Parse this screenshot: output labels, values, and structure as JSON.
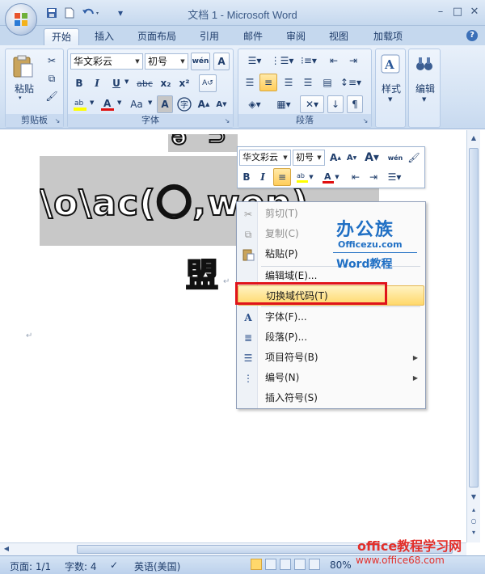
{
  "window": {
    "title": "文档 1 - Microsoft Word",
    "minimize": "–",
    "maximize": "□",
    "close": "✕"
  },
  "qat": {
    "save_icon": "save-icon",
    "new_icon": "new-doc-icon",
    "undo_icon": "undo-icon",
    "customize": "▾"
  },
  "tabs": [
    "开始",
    "插入",
    "页面布局",
    "引用",
    "邮件",
    "审阅",
    "视图",
    "加载项"
  ],
  "ribbon": {
    "clipboard": {
      "paste": "粘贴",
      "label": "剪贴板"
    },
    "font": {
      "font_name": "华文彩云",
      "font_size": "初号",
      "bold": "B",
      "italic": "I",
      "underline": "U",
      "strike": "abc",
      "subscript": "x₂",
      "superscript": "x²",
      "aa": "Aa",
      "label": "字体"
    },
    "paragraph": {
      "label": "段落"
    },
    "styles": {
      "label": "样式"
    },
    "editing": {
      "label": "编辑"
    }
  },
  "document": {
    "field_text": "\\o\\ac(〇,wen)",
    "top_fragment": "ǝ ⊃ q",
    "char_display": "盟",
    "para_mark": "↵"
  },
  "mini_toolbar": {
    "font_name": "华文彩云",
    "font_size": "初号",
    "bold": "B",
    "italic": "I"
  },
  "context_menu": {
    "items": [
      {
        "label": "剪切(T)",
        "icon": "scissors-icon",
        "disabled": true
      },
      {
        "label": "复制(C)",
        "icon": "copy-icon",
        "disabled": true
      },
      {
        "label": "粘贴(P)",
        "icon": "paste-icon",
        "disabled": false
      },
      {
        "label": "编辑域(E)...",
        "icon": "",
        "disabled": false
      },
      {
        "label": "切换域代码(T)",
        "icon": "",
        "disabled": false,
        "highlighted": true
      },
      {
        "label": "字体(F)...",
        "icon": "font-icon",
        "disabled": false
      },
      {
        "label": "段落(P)...",
        "icon": "paragraph-icon",
        "disabled": false
      },
      {
        "label": "项目符号(B)",
        "icon": "bullets-icon",
        "disabled": false,
        "submenu": true
      },
      {
        "label": "编号(N)",
        "icon": "numbering-icon",
        "disabled": false,
        "submenu": true
      },
      {
        "label": "插入符号(S)",
        "icon": "",
        "disabled": false
      }
    ]
  },
  "watermark": {
    "logo_text": "办公族",
    "logo_url": "Officezu.com",
    "logo_sub": "Word教程",
    "site_name": "office教程学习网",
    "site_url": "www.office68.com"
  },
  "status": {
    "page": "页面: 1/1",
    "words": "字数: 4",
    "language": "英语(美国)",
    "zoom": "80%"
  },
  "colors": {
    "accent": "#c5d8ee",
    "highlight_box": "#e0131a",
    "watermark": "#e3302b"
  }
}
